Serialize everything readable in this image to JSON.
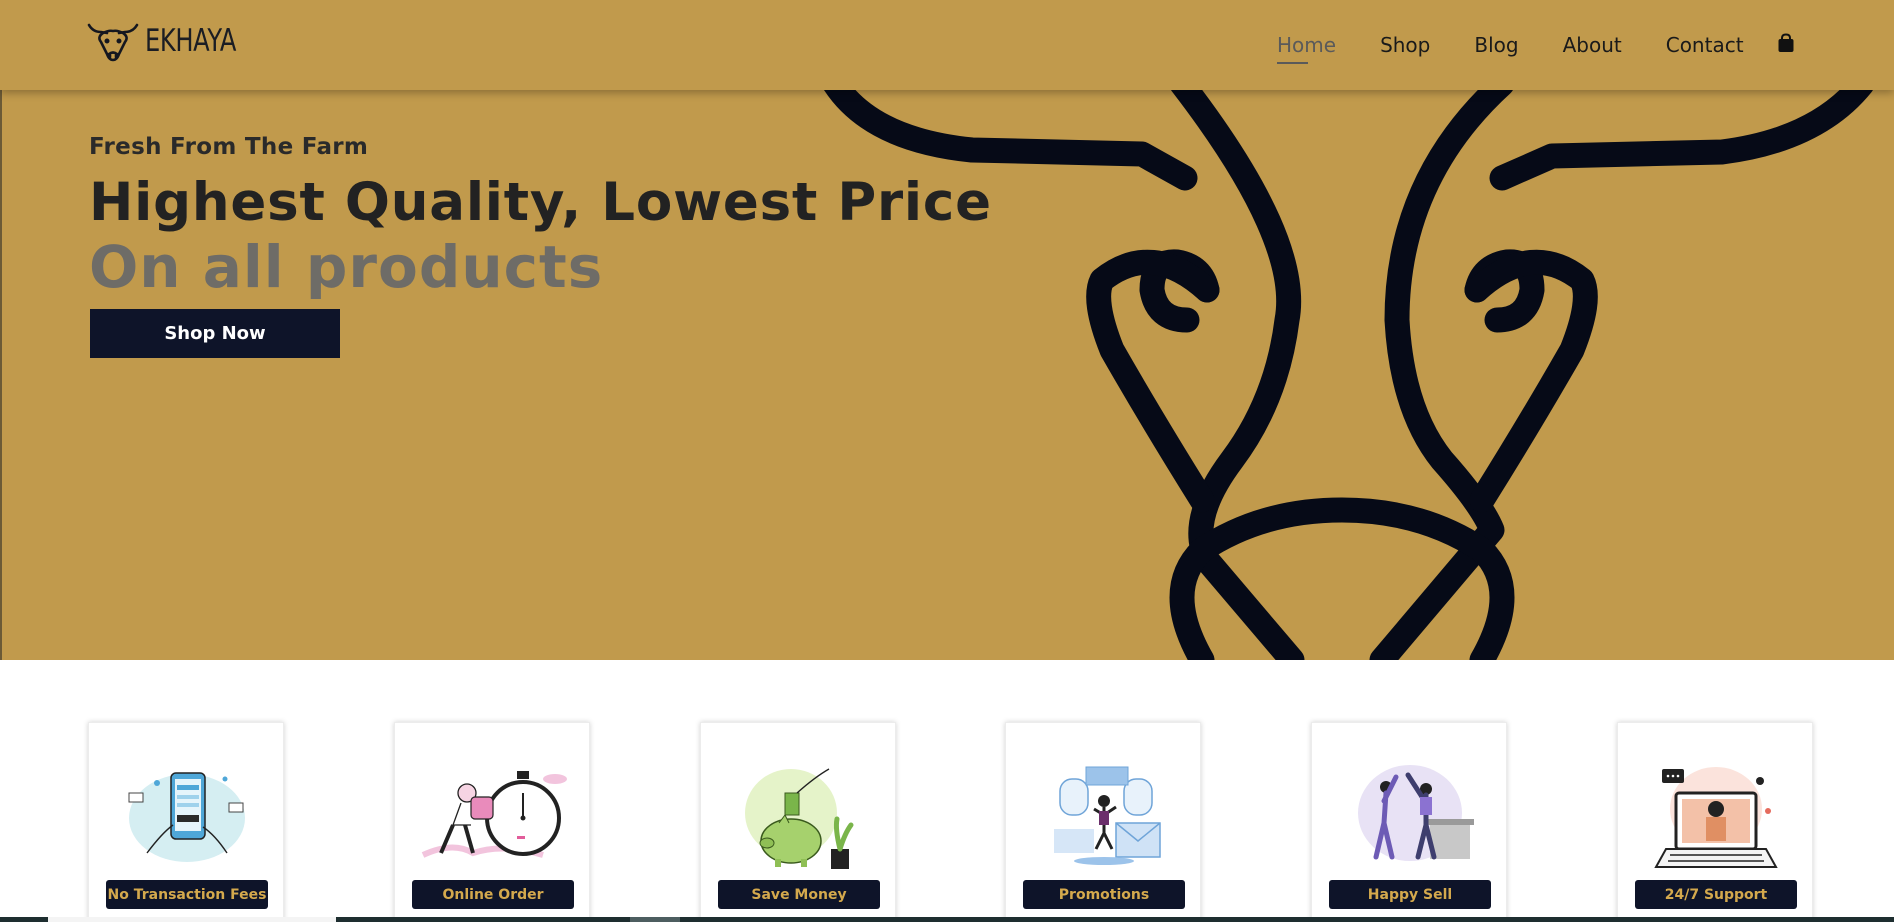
{
  "brand": {
    "name": "EKHAYA",
    "colors": {
      "primary_gold": "#c19a4c",
      "dark_navy": "#0e1429",
      "label_gold": "#d4a94d"
    }
  },
  "nav": {
    "items": [
      {
        "label": "Home",
        "active": true
      },
      {
        "label": "Shop",
        "active": false
      },
      {
        "label": "Blog",
        "active": false
      },
      {
        "label": "About",
        "active": false
      },
      {
        "label": "Contact",
        "active": false
      }
    ],
    "cart_icon": "shopping-bag-icon"
  },
  "hero": {
    "pretitle": "Fresh From The Farm",
    "title": "Highest Quality, Lowest Price",
    "subtitle": "On all products",
    "cta_label": "Shop Now",
    "art_icon": "bull-head-outline"
  },
  "features": [
    {
      "label": "No Transaction Fees",
      "icon": "mobile-payment-illustration"
    },
    {
      "label": "Online Order",
      "icon": "delivery-stopwatch-illustration"
    },
    {
      "label": "Save Money",
      "icon": "piggy-bank-illustration"
    },
    {
      "label": "Promotions",
      "icon": "email-promotion-illustration"
    },
    {
      "label": "Happy Sell",
      "icon": "high-five-illustration"
    },
    {
      "label": "24/7 Support",
      "icon": "laptop-support-illustration"
    }
  ]
}
